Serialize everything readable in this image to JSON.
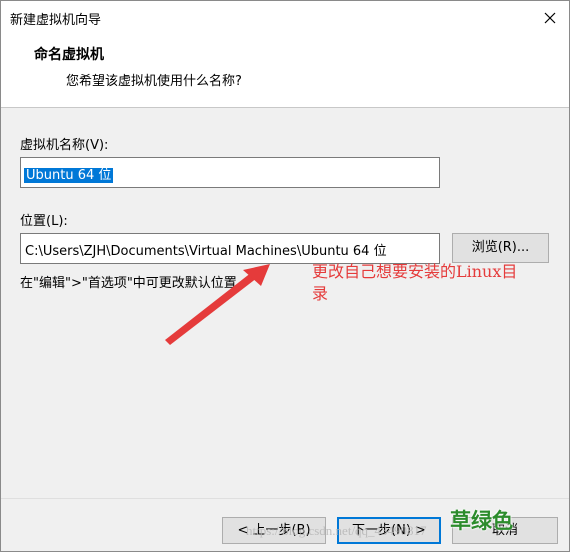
{
  "window": {
    "title": "新建虚拟机向导",
    "close_symbol": "✕"
  },
  "header": {
    "heading": "命名虚拟机",
    "subheading": "您希望该虚拟机使用什么名称?"
  },
  "form": {
    "name_label": "虚拟机名称(V):",
    "name_value": "Ubuntu 64 位",
    "location_label": "位置(L):",
    "location_value": "C:\\Users\\ZJH\\Documents\\Virtual Machines\\Ubuntu 64 位",
    "browse_label": "浏览(R)...",
    "hint_text": "在\"编辑\">\"首选项\"中可更改默认位置。"
  },
  "footer": {
    "back_label": "< 上一步(B)",
    "next_label": "下一步(N) >",
    "cancel_label": "取消"
  },
  "annotation": {
    "text_line1": "更改自己想要安装的Linux目",
    "text_line2": "录",
    "color": "#e53b3b"
  },
  "overlay": {
    "watermark_text": "https://blog.csdn.net/qq_43490817",
    "logo_text": "草绿色"
  },
  "colors": {
    "accent": "#0078d7",
    "panel": "#f0f0f0"
  }
}
